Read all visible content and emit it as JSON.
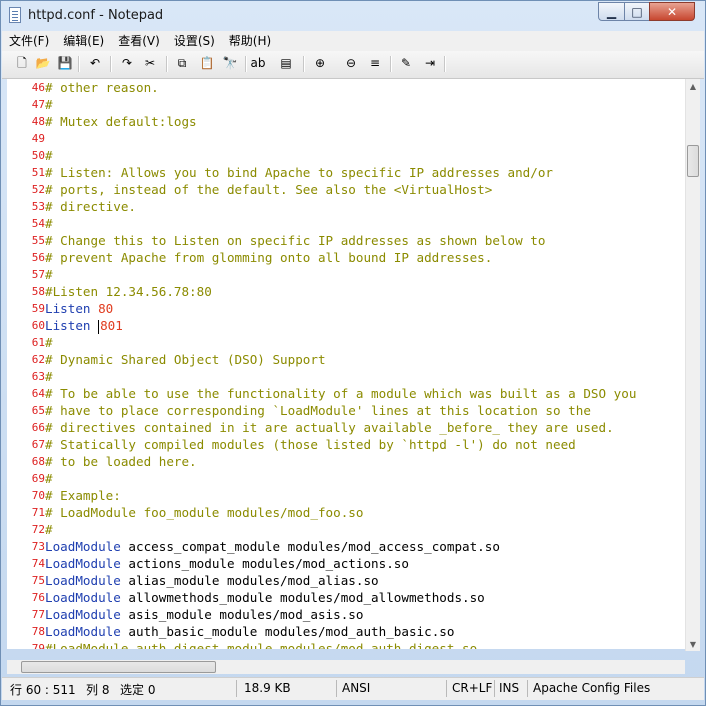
{
  "window": {
    "title": "httpd.conf - Notepad"
  },
  "title_buttons": {
    "minimize": "▁",
    "maximize": "□",
    "close": "✕"
  },
  "menu": [
    "文件(F)",
    "编辑(E)",
    "查看(V)",
    "设置(S)",
    "帮助(H)"
  ],
  "toolbar": [
    {
      "name": "new-file-icon",
      "glyph": "🗋"
    },
    {
      "name": "open-folder-icon",
      "glyph": "📂"
    },
    {
      "name": "save-icon",
      "glyph": "💾"
    },
    {
      "name": "undo-icon",
      "glyph": "↶"
    },
    {
      "name": "redo-icon",
      "glyph": "↷"
    },
    {
      "name": "cut-icon",
      "glyph": "✂"
    },
    {
      "name": "copy-icon",
      "glyph": "⧉"
    },
    {
      "name": "paste-icon",
      "glyph": "📋"
    },
    {
      "name": "find-icon",
      "glyph": "🔭"
    },
    {
      "name": "replace-icon",
      "glyph": "ab"
    },
    {
      "name": "goto-icon",
      "glyph": "▤"
    },
    {
      "name": "zoom-in-icon",
      "glyph": "⊕"
    },
    {
      "name": "zoom-out-icon",
      "glyph": "⊖"
    },
    {
      "name": "wordwrap-icon",
      "glyph": "≡"
    },
    {
      "name": "scheme-icon",
      "glyph": "✎"
    },
    {
      "name": "exit-icon",
      "glyph": "⇥"
    }
  ],
  "colors": {
    "comment": "#8b8b00",
    "directive": "#1f3fb0",
    "number": "#e03c1f",
    "line_number": "#dd2020"
  },
  "lines": [
    {
      "n": "46",
      "parts": [
        {
          "t": "# other reason.",
          "c": "comment"
        }
      ]
    },
    {
      "n": "47",
      "parts": [
        {
          "t": "#",
          "c": "comment"
        }
      ]
    },
    {
      "n": "48",
      "parts": [
        {
          "t": "# Mutex default:logs",
          "c": "comment"
        }
      ]
    },
    {
      "n": "49",
      "parts": []
    },
    {
      "n": "50",
      "parts": [
        {
          "t": "#",
          "c": "comment"
        }
      ]
    },
    {
      "n": "51",
      "parts": [
        {
          "t": "# Listen: Allows you to bind Apache to specific IP addresses and/or",
          "c": "comment"
        }
      ]
    },
    {
      "n": "52",
      "parts": [
        {
          "t": "# ports, instead of the default. See also the <VirtualHost>",
          "c": "comment"
        }
      ]
    },
    {
      "n": "53",
      "parts": [
        {
          "t": "# directive.",
          "c": "comment"
        }
      ]
    },
    {
      "n": "54",
      "parts": [
        {
          "t": "#",
          "c": "comment"
        }
      ]
    },
    {
      "n": "55",
      "parts": [
        {
          "t": "# Change this to Listen on specific IP addresses as shown below to",
          "c": "comment"
        }
      ]
    },
    {
      "n": "56",
      "parts": [
        {
          "t": "# prevent Apache from glomming onto all bound IP addresses.",
          "c": "comment"
        }
      ]
    },
    {
      "n": "57",
      "parts": [
        {
          "t": "#",
          "c": "comment"
        }
      ]
    },
    {
      "n": "58",
      "parts": [
        {
          "t": "#Listen 12.34.56.78:80",
          "c": "comment"
        }
      ]
    },
    {
      "n": "59",
      "parts": [
        {
          "t": "Listen",
          "c": "dir"
        },
        {
          "t": " ",
          "c": ""
        },
        {
          "t": "80",
          "c": "num"
        }
      ]
    },
    {
      "n": "60",
      "parts": [
        {
          "t": "Listen",
          "c": "dir"
        },
        {
          "t": " ",
          "c": ""
        },
        {
          "t": "",
          "c": "caret"
        },
        {
          "t": "801",
          "c": "num"
        }
      ]
    },
    {
      "n": "61",
      "parts": [
        {
          "t": "#",
          "c": "comment"
        }
      ]
    },
    {
      "n": "62",
      "parts": [
        {
          "t": "# Dynamic Shared Object (DSO) Support",
          "c": "comment"
        }
      ]
    },
    {
      "n": "63",
      "parts": [
        {
          "t": "#",
          "c": "comment"
        }
      ]
    },
    {
      "n": "64",
      "parts": [
        {
          "t": "# To be able to use the functionality of a module which was built as a DSO you",
          "c": "comment"
        }
      ]
    },
    {
      "n": "65",
      "parts": [
        {
          "t": "# have to place corresponding `LoadModule' lines at this location so the",
          "c": "comment"
        }
      ]
    },
    {
      "n": "66",
      "parts": [
        {
          "t": "# directives contained in it are actually available _before_ they are used.",
          "c": "comment"
        }
      ]
    },
    {
      "n": "67",
      "parts": [
        {
          "t": "# Statically compiled modules (those listed by `httpd -l') do not need",
          "c": "comment"
        }
      ]
    },
    {
      "n": "68",
      "parts": [
        {
          "t": "# to be loaded here.",
          "c": "comment"
        }
      ]
    },
    {
      "n": "69",
      "parts": [
        {
          "t": "#",
          "c": "comment"
        }
      ]
    },
    {
      "n": "70",
      "parts": [
        {
          "t": "# Example:",
          "c": "comment"
        }
      ]
    },
    {
      "n": "71",
      "parts": [
        {
          "t": "# LoadModule foo_module modules/mod_foo.so",
          "c": "comment"
        }
      ]
    },
    {
      "n": "72",
      "parts": [
        {
          "t": "#",
          "c": "comment"
        }
      ]
    },
    {
      "n": "73",
      "parts": [
        {
          "t": "LoadModule",
          "c": "dir"
        },
        {
          "t": " access_compat_module modules/mod_access_compat.so",
          "c": ""
        }
      ]
    },
    {
      "n": "74",
      "parts": [
        {
          "t": "LoadModule",
          "c": "dir"
        },
        {
          "t": " actions_module modules/mod_actions.so",
          "c": ""
        }
      ]
    },
    {
      "n": "75",
      "parts": [
        {
          "t": "LoadModule",
          "c": "dir"
        },
        {
          "t": " alias_module modules/mod_alias.so",
          "c": ""
        }
      ]
    },
    {
      "n": "76",
      "parts": [
        {
          "t": "LoadModule",
          "c": "dir"
        },
        {
          "t": " allowmethods_module modules/mod_allowmethods.so",
          "c": ""
        }
      ]
    },
    {
      "n": "77",
      "parts": [
        {
          "t": "LoadModule",
          "c": "dir"
        },
        {
          "t": " asis_module modules/mod_asis.so",
          "c": ""
        }
      ]
    },
    {
      "n": "78",
      "parts": [
        {
          "t": "LoadModule",
          "c": "dir"
        },
        {
          "t": " auth_basic_module modules/mod_auth_basic.so",
          "c": ""
        }
      ]
    },
    {
      "n": "79",
      "parts": [
        {
          "t": "#LoadModule auth_digest_module modules/mod_auth_digest.so",
          "c": "comment"
        }
      ]
    }
  ],
  "status": {
    "position": "行 60 : 511",
    "column": "列 8",
    "selection": "选定 0",
    "size": "18.9 KB",
    "encoding": "ANSI",
    "line_ending": "CR+LF",
    "mode": "INS",
    "scheme": "Apache Config Files"
  }
}
